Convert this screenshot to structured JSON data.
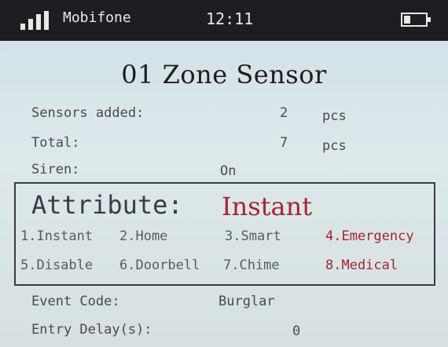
{
  "status_bar": {
    "carrier": "Mobifone",
    "time": "12:11",
    "signal_icon": "signal-bars-icon",
    "battery_icon": "battery-icon",
    "battery_level": 0.3
  },
  "page": {
    "title": "01 Zone Sensor"
  },
  "info": {
    "sensors_added": {
      "label": "Sensors added:",
      "value": "2",
      "unit": "pcs"
    },
    "total": {
      "label": "Total:",
      "value": "7",
      "unit": "pcs"
    },
    "siren": {
      "label": "Siren:",
      "value": "On"
    }
  },
  "attribute": {
    "label": "Attribute:",
    "value": "Instant",
    "options": [
      "1.Instant",
      "2.Home",
      "3.Smart",
      "4.Emergency",
      "5.Disable",
      "6.Doorbell",
      "7.Chime",
      "8.Medical"
    ]
  },
  "event": {
    "label": "Event Code:",
    "value": "Burglar"
  },
  "entry_delay": {
    "label": "Entry Delay(s):",
    "value": "0"
  },
  "colors": {
    "accent_red": "#a3262c",
    "status_bar_bg": "#1e1e22",
    "box_border": "#3a3a46"
  }
}
